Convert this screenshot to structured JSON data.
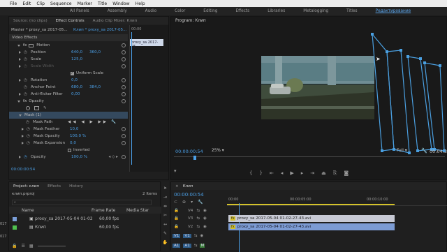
{
  "menu": [
    "File",
    "Edit",
    "Clip",
    "Sequence",
    "Marker",
    "Title",
    "Window",
    "Help"
  ],
  "workspaces": {
    "items": [
      "All Panels",
      "Assembly",
      "Audio",
      "Color",
      "Editing",
      "Effects",
      "Libraries",
      "Metalogging",
      "Titles",
      "Редактирование"
    ],
    "active_index": 9
  },
  "effect_panel": {
    "tabs": [
      "Source: (no clips)",
      "Effect Controls",
      "Audio Clip Mixer: Клип"
    ],
    "source_label": "Master * proxy_sa 2017-05...",
    "clip_label": "Клип * proxy_sa 2017-05...",
    "mini_timecode": "00:00",
    "mini_clip": "proxy_sa 2017-05",
    "section_video": "Video Effects",
    "motion": {
      "label": "Motion",
      "position_label": "Position",
      "position_x": "640,0",
      "position_y": "360,0",
      "scale_label": "Scale",
      "scale_value": "125,0",
      "scale_width_label": "Scale Width",
      "uniform_label": "Uniform Scale",
      "rotation_label": "Rotation",
      "rotation_value": "0,0",
      "anchor_label": "Anchor Point",
      "anchor_x": "680,0",
      "anchor_y": "384,0",
      "flicker_label": "Anti-flicker Filter",
      "flicker_value": "0,00"
    },
    "opacity": {
      "label": "Opacity",
      "mask_label": "Mask (1)",
      "mask_path_label": "Mask Path",
      "mask_feather_label": "Mask Feather",
      "mask_feather_value": "10,0",
      "mask_opacity_label": "Mask Opacity",
      "mask_opacity_value": "100,0 %",
      "mask_expansion_label": "Mask Expansion",
      "mask_expansion_value": "0,0",
      "inverted_label": "Inverted",
      "opacity_label": "Opacity",
      "opacity_value": "100,0 %"
    },
    "timecode": "00:00:00:54"
  },
  "program": {
    "title": "Program: Клип",
    "timecode": "00:00:00:54",
    "zoom": "25%",
    "quality": "Full",
    "duration": "00:04:3"
  },
  "project": {
    "tabs": [
      "Project: клип",
      "Effects",
      "History"
    ],
    "file": "клип.prproj",
    "items_count": "2 Items",
    "col_name": "Name",
    "col_rate": "Frame Rate",
    "col_media": "Media Star",
    "rows": [
      {
        "name": "proxy_sa 2017-05-04 01-02",
        "rate": "60,00 fps",
        "color": "#7a9ed8"
      },
      {
        "name": "Клип",
        "rate": "60,00 fps",
        "color": "#4fc04f"
      }
    ]
  },
  "timeline": {
    "tab": "Клип",
    "timecode": "00:00:00:54",
    "ruler": [
      "00:00",
      "00:00:05:00",
      "00:00:10:00"
    ],
    "tracks": [
      "V4",
      "V3",
      "V2",
      "V1",
      "A1"
    ],
    "clip_v2": "proxy_sa 2017-05-04 01-02-27-43.avi",
    "clip_v1": "proxy_sa 2017-05-04 01-02-27-43.avi"
  },
  "left_edge": [
    "017",
    "017"
  ],
  "colors": {
    "accent": "#4b9fe6",
    "mask_stroke": "#4a9fe0",
    "clip_v2": "#c7c9d4",
    "clip_v1": "#7c9bd3"
  }
}
